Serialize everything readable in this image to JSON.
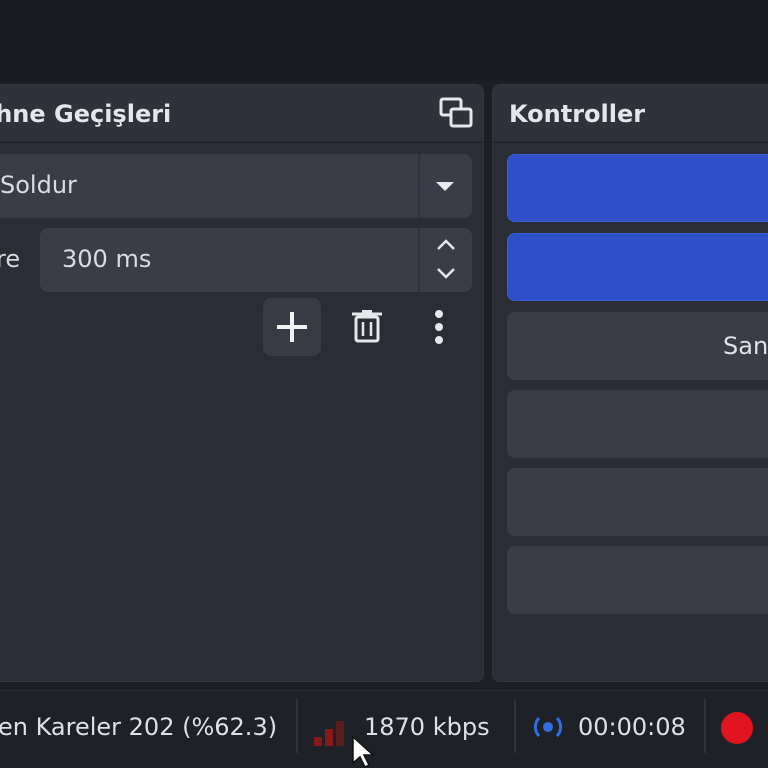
{
  "transitions": {
    "title": "ahne Geçişleri",
    "selected_transition": "Soldur",
    "duration_label": "re",
    "duration_value": "300 ms"
  },
  "controls": {
    "title": "Kontroller",
    "buttons": [
      {
        "label": "",
        "style": "primary"
      },
      {
        "label": "",
        "style": "primary"
      },
      {
        "label": "San",
        "style": "default"
      },
      {
        "label": "",
        "style": "default"
      },
      {
        "label": "",
        "style": "default"
      },
      {
        "label": "",
        "style": "default"
      }
    ]
  },
  "status": {
    "dropped_frames": "en Kareler 202 (%62.3)",
    "bitrate": "1870 kbps",
    "stream_time": "00:00:08"
  },
  "colors": {
    "accent": "#2d4fc7",
    "record": "#e0141e",
    "network_bars": "#8a1a1a",
    "stream_icon": "#2f6fe0"
  },
  "icons": {
    "undock": "undock-icon",
    "dropdown": "chevron-down-icon",
    "spin_up": "chevron-up-icon",
    "spin_down": "chevron-down-icon",
    "add": "plus-icon",
    "delete": "trash-icon",
    "more": "more-vertical-icon",
    "network": "signal-bars-icon",
    "stream": "broadcast-icon",
    "record": "record-dot-icon",
    "cursor": "mouse-cursor-icon"
  }
}
